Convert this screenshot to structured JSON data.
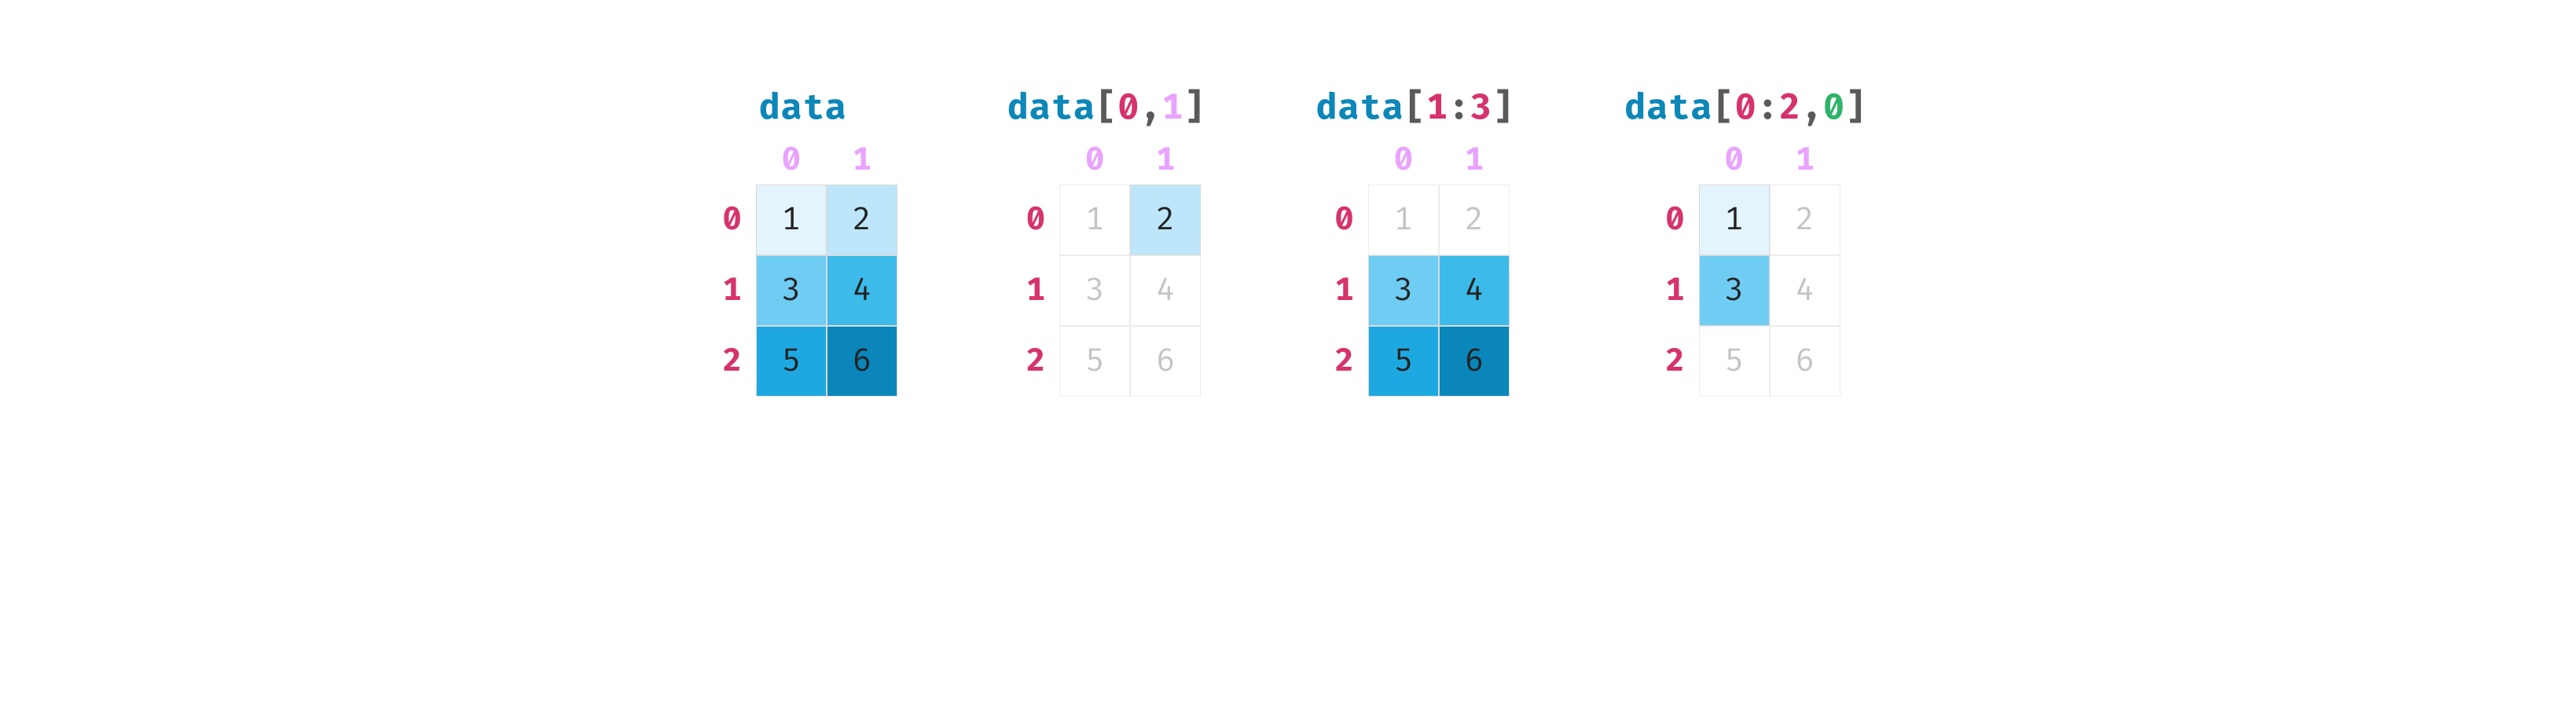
{
  "rowLabels": [
    "0",
    "1",
    "2"
  ],
  "colLabels": [
    "0",
    "1"
  ],
  "cellShades": [
    "shade-0",
    "shade-1",
    "shade-2",
    "shade-3",
    "shade-4",
    "shade-5"
  ],
  "panels": [
    {
      "title": [
        {
          "text": "data",
          "cls": "t-data"
        }
      ],
      "cells": [
        {
          "v": "1",
          "active": true,
          "shade": 0
        },
        {
          "v": "2",
          "active": true,
          "shade": 1
        },
        {
          "v": "3",
          "active": true,
          "shade": 2
        },
        {
          "v": "4",
          "active": true,
          "shade": 3
        },
        {
          "v": "5",
          "active": true,
          "shade": 4
        },
        {
          "v": "6",
          "active": true,
          "shade": 5
        }
      ]
    },
    {
      "title": [
        {
          "text": "data",
          "cls": "t-data"
        },
        {
          "text": "[",
          "cls": "t-bracket"
        },
        {
          "text": "0",
          "cls": "t-pink"
        },
        {
          "text": ",",
          "cls": "t-bracket"
        },
        {
          "text": "1",
          "cls": "t-violet"
        },
        {
          "text": "]",
          "cls": "t-bracket"
        }
      ],
      "cells": [
        {
          "v": "1",
          "active": false
        },
        {
          "v": "2",
          "active": true,
          "shade": 1
        },
        {
          "v": "3",
          "active": false
        },
        {
          "v": "4",
          "active": false
        },
        {
          "v": "5",
          "active": false
        },
        {
          "v": "6",
          "active": false
        }
      ]
    },
    {
      "title": [
        {
          "text": "data",
          "cls": "t-data"
        },
        {
          "text": "[",
          "cls": "t-bracket"
        },
        {
          "text": "1",
          "cls": "t-pink"
        },
        {
          "text": ":",
          "cls": "t-bracket"
        },
        {
          "text": "3",
          "cls": "t-pink"
        },
        {
          "text": "]",
          "cls": "t-bracket"
        }
      ],
      "cells": [
        {
          "v": "1",
          "active": false
        },
        {
          "v": "2",
          "active": false
        },
        {
          "v": "3",
          "active": true,
          "shade": 2
        },
        {
          "v": "4",
          "active": true,
          "shade": 3
        },
        {
          "v": "5",
          "active": true,
          "shade": 4
        },
        {
          "v": "6",
          "active": true,
          "shade": 5
        }
      ]
    },
    {
      "title": [
        {
          "text": "data",
          "cls": "t-data"
        },
        {
          "text": "[",
          "cls": "t-bracket"
        },
        {
          "text": "0",
          "cls": "t-pink"
        },
        {
          "text": ":",
          "cls": "t-bracket"
        },
        {
          "text": "2",
          "cls": "t-pink"
        },
        {
          "text": ",",
          "cls": "t-bracket"
        },
        {
          "text": "0",
          "cls": "t-green"
        },
        {
          "text": "]",
          "cls": "t-bracket"
        }
      ],
      "cells": [
        {
          "v": "1",
          "active": true,
          "shade": 0
        },
        {
          "v": "2",
          "active": false
        },
        {
          "v": "3",
          "active": true,
          "shade": 2
        },
        {
          "v": "4",
          "active": false
        },
        {
          "v": "5",
          "active": false
        },
        {
          "v": "6",
          "active": false
        }
      ]
    }
  ]
}
